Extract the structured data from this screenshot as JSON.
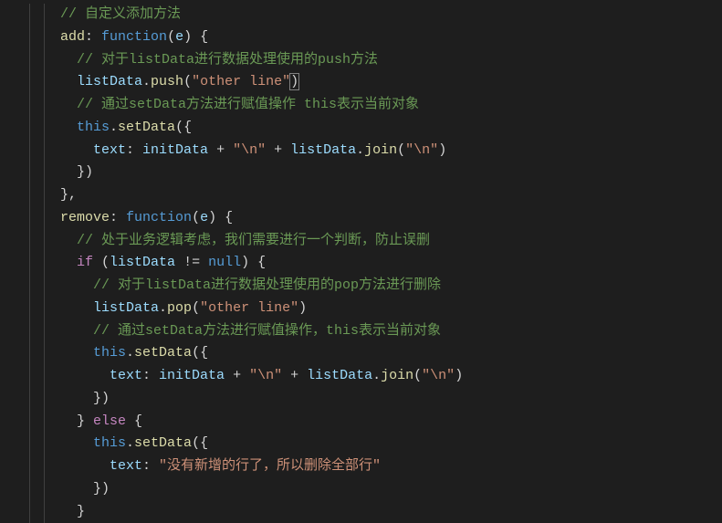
{
  "code": {
    "l01_comment": "// 自定义添加方法",
    "l02_add": "add",
    "l02_function": "function",
    "l02_param": "e",
    "l03_comment": "// 对于listData进行数据处理使用的push方法",
    "l04_var": "listData",
    "l04_method": "push",
    "l04_string": "\"other line\"",
    "l05_comment": "// 通过setData方法进行赋值操作 this表示当前对象",
    "l06_this": "this",
    "l06_method": "setData",
    "l07_key": "text",
    "l07_var1": "initData",
    "l07_str1": "\"\\n\"",
    "l07_var2": "listData",
    "l07_method": "join",
    "l07_str2": "\"\\n\"",
    "l10_remove": "remove",
    "l10_function": "function",
    "l10_param": "e",
    "l11_comment": "// 处于业务逻辑考虑，我们需要进行一个判断，防止误删",
    "l12_if": "if",
    "l12_var": "listData",
    "l12_null": "null",
    "l13_comment": "// 对于listData进行数据处理使用的pop方法进行删除",
    "l14_var": "listData",
    "l14_method": "pop",
    "l14_string": "\"other line\"",
    "l15_comment": "// 通过setData方法进行赋值操作，this表示当前对象",
    "l16_this": "this",
    "l16_method": "setData",
    "l17_key": "text",
    "l17_var1": "initData",
    "l17_str1": "\"\\n\"",
    "l17_var2": "listData",
    "l17_method": "join",
    "l17_str2": "\"\\n\"",
    "l19_else": "else",
    "l20_this": "this",
    "l20_method": "setData",
    "l21_key": "text",
    "l21_string": "\"没有新增的行了，所以删除全部行\""
  }
}
